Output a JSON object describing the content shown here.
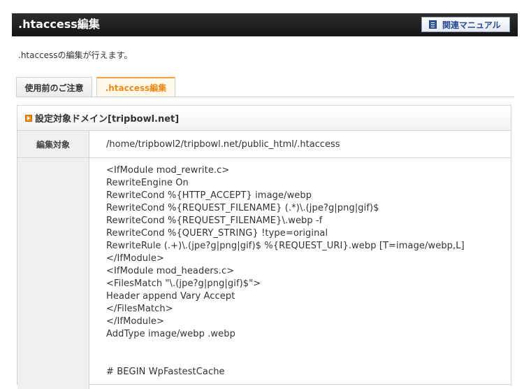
{
  "header": {
    "title": ".htaccess編集",
    "manual_button": "関連マニュアル",
    "manual_icon": "book-icon"
  },
  "intro": ".htaccessの編集が行えます。",
  "tabs": [
    {
      "label": "使用前のご注意",
      "active": false
    },
    {
      "label": ".htaccess編集",
      "active": true
    }
  ],
  "panel": {
    "heading": "設定対象ドメイン[tripbowl.net]",
    "heading_icon": "arrow-icon",
    "target_label": "編集対象",
    "target_path": "/home/tripbowl2/tripbowl.net/public_html/.htaccess",
    "editor_content": "<IfModule mod_rewrite.c>\nRewriteEngine On\nRewriteCond %{HTTP_ACCEPT} image/webp\nRewriteCond %{REQUEST_FILENAME} (.*)\\.(jpe?g|png|gif)$\nRewriteCond %{REQUEST_FILENAME}\\.webp -f\nRewriteCond %{QUERY_STRING} !type=original\nRewriteRule (.+)\\.(jpe?g|png|gif)$ %{REQUEST_URI}.webp [T=image/webp,L]\n</IfModule>\n<IfModule mod_headers.c>\n<FilesMatch \"\\.(jpe?g|png|gif)$\">\nHeader append Vary Accept\n</FilesMatch>\n</IfModule>\nAddType image/webp .webp\n\n\n# BEGIN WpFastestCache"
  },
  "colors": {
    "header_bg": "#1f1f1f",
    "tab_active": "#ee8a1a",
    "manual_text": "#234a8f"
  }
}
